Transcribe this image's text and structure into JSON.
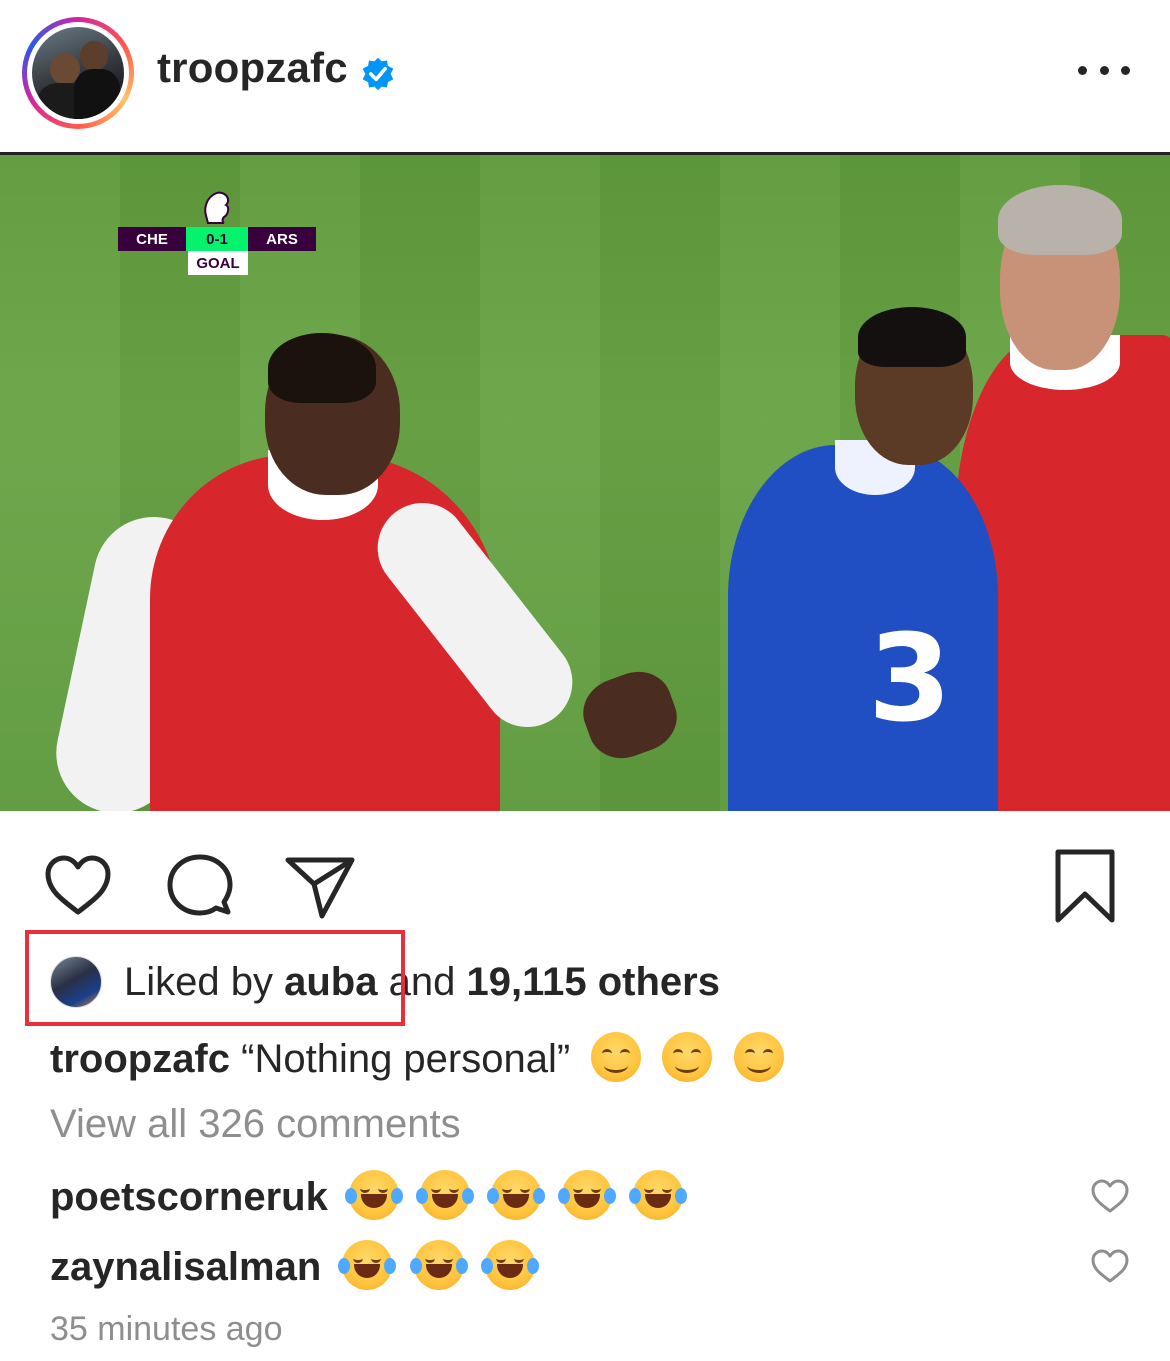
{
  "post": {
    "username": "troopzafc",
    "verified": true,
    "more_icon": "more-horizontal-icon"
  },
  "scorebug": {
    "home": "CHE",
    "score": "0-1",
    "away": "ARS",
    "event": "GOAL"
  },
  "actions": {
    "like_icon": "heart-icon",
    "comment_icon": "comment-icon",
    "share_icon": "send-icon",
    "save_icon": "bookmark-icon"
  },
  "likes": {
    "prefix": "Liked by",
    "user": "auba",
    "middle": "and",
    "count": "19,115 others"
  },
  "caption": {
    "username": "troopzafc",
    "text": "“Nothing personal”",
    "emojis": [
      "smiling-face-icon",
      "smiling-face-icon",
      "smiling-face-icon"
    ]
  },
  "view_all_comments": "View all 326 comments",
  "comments": [
    {
      "username": "poetscorneruk",
      "emoji_count": 5,
      "emoji": "tears-of-joy-icon"
    },
    {
      "username": "zaynalisalman",
      "emoji_count": 3,
      "emoji": "tears-of-joy-icon"
    }
  ],
  "timestamp": "35 minutes ago",
  "colors": {
    "highlight": "#e8303a",
    "verified": "#0095f6",
    "text": "#262626",
    "muted": "#8e8e8e"
  }
}
